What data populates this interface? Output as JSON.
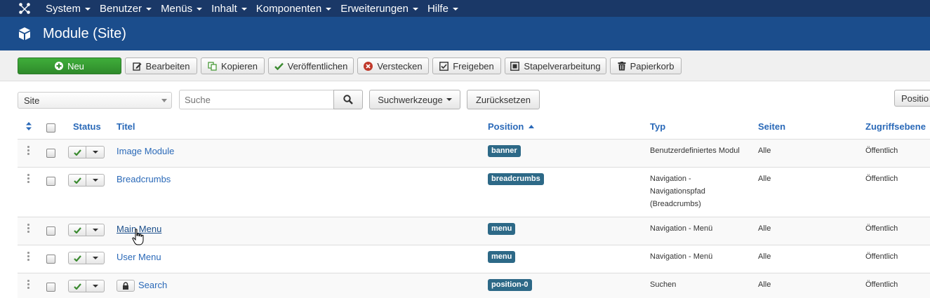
{
  "topnav": {
    "items": [
      "System",
      "Benutzer",
      "Menüs",
      "Inhalt",
      "Komponenten",
      "Erweiterungen",
      "Hilfe"
    ]
  },
  "header": {
    "title": "Module (Site)"
  },
  "toolbar": {
    "new": "Neu",
    "edit": "Bearbeiten",
    "copy": "Kopieren",
    "publish": "Veröffentlichen",
    "unpublish": "Verstecken",
    "checkin": "Freigeben",
    "batch": "Stapelverarbeitung",
    "trash": "Papierkorb"
  },
  "filters": {
    "client_select": "Site",
    "search_placeholder": "Suche",
    "search_tools": "Suchwerkzeuge",
    "reset": "Zurücksetzen",
    "sort_partial": "Positio"
  },
  "table": {
    "headers": {
      "status": "Status",
      "title": "Titel",
      "position": "Position",
      "type": "Typ",
      "pages": "Seiten",
      "access": "Zugriffsebene"
    },
    "rows": [
      {
        "title": "Image Module",
        "position": "banner",
        "type": [
          "Benutzerdefiniertes Modul"
        ],
        "pages": "Alle",
        "access": "Öffentlich"
      },
      {
        "title": "Breadcrumbs",
        "position": "breadcrumbs",
        "type": [
          "Navigation -",
          "Navigationspfad",
          "(Breadcrumbs)"
        ],
        "pages": "Alle",
        "access": "Öffentlich"
      },
      {
        "title": "Main Menu",
        "position": "menu",
        "type": [
          "Navigation - Menü"
        ],
        "pages": "Alle",
        "access": "Öffentlich"
      },
      {
        "title": "User Menu",
        "position": "menu",
        "type": [
          "Navigation - Menü"
        ],
        "pages": "Alle",
        "access": "Öffentlich"
      },
      {
        "title": "Search",
        "position": "position-0",
        "type": [
          "Suchen"
        ],
        "pages": "Alle",
        "access": "Öffentlich"
      }
    ]
  },
  "colors": {
    "topnav": "#1a3867",
    "header": "#1b4d8c",
    "link": "#2a69b8",
    "badge": "#2d6987",
    "new_button": "#3fae3a",
    "check": "#3a8a2f",
    "unpublish_icon": "#c0392b"
  }
}
